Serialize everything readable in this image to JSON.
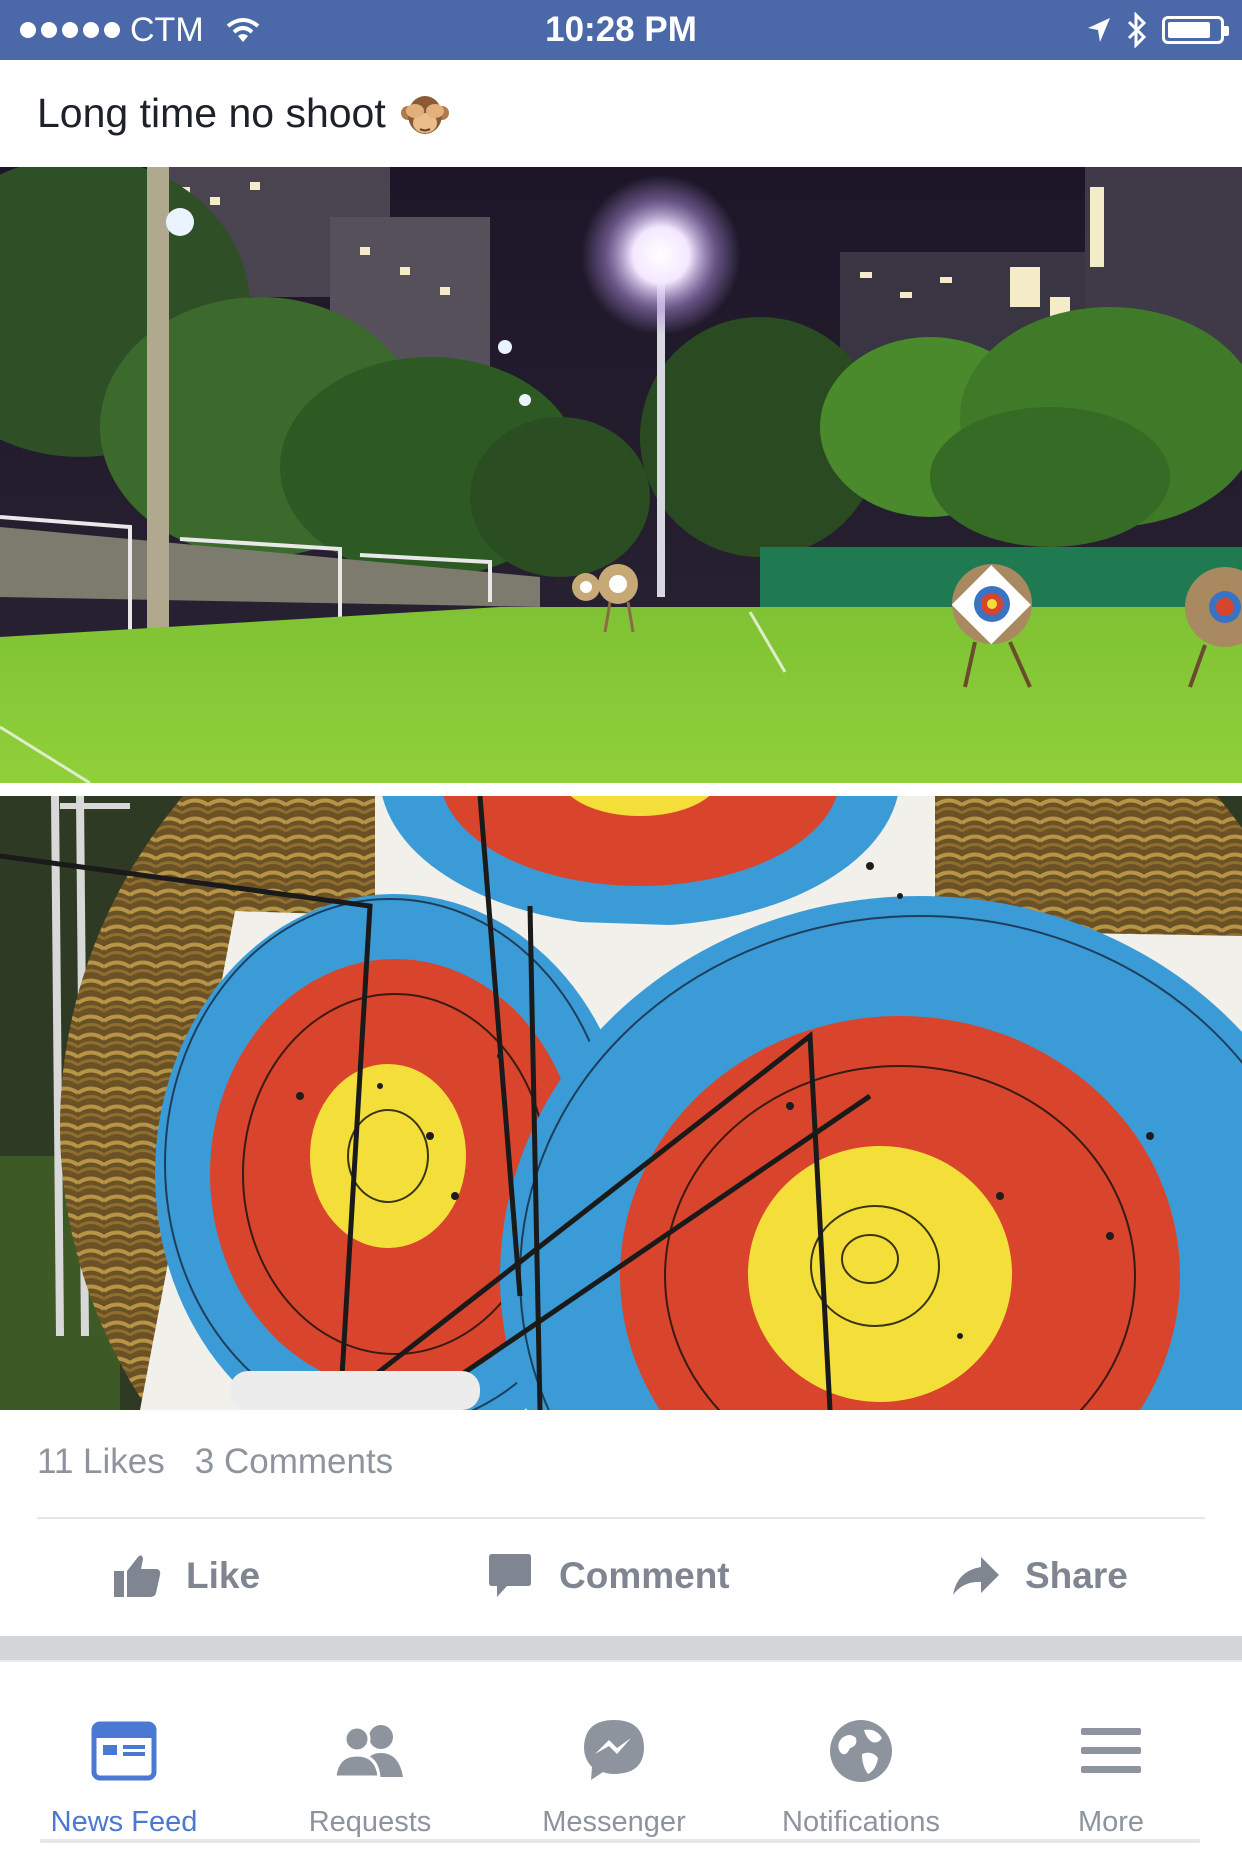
{
  "status_bar": {
    "carrier": "CTM",
    "time": "10:28 PM",
    "icons": [
      "signal-dots-icon",
      "wifi-icon",
      "location-arrow-icon",
      "bluetooth-icon",
      "battery-icon"
    ]
  },
  "post": {
    "text": "Long time no shoot",
    "emoji": "see-no-evil-monkey-icon",
    "photos": [
      "archery-field-night-photo",
      "archery-targets-closeup-photo"
    ],
    "likes": "11 Likes",
    "comments": "3 Comments",
    "actions": {
      "like": "Like",
      "comment": "Comment",
      "share": "Share"
    }
  },
  "tab_bar": {
    "tabs": [
      {
        "label": "News Feed",
        "icon": "news-feed-icon",
        "active": true
      },
      {
        "label": "Requests",
        "icon": "friend-requests-icon",
        "active": false
      },
      {
        "label": "Messenger",
        "icon": "messenger-icon",
        "active": false
      },
      {
        "label": "Notifications",
        "icon": "globe-notifications-icon",
        "active": false
      },
      {
        "label": "More",
        "icon": "hamburger-menu-icon",
        "active": false
      }
    ]
  },
  "colors": {
    "status_bar": "#4b69a8",
    "active_tab": "#4a78d3",
    "inactive": "#8d949e"
  }
}
